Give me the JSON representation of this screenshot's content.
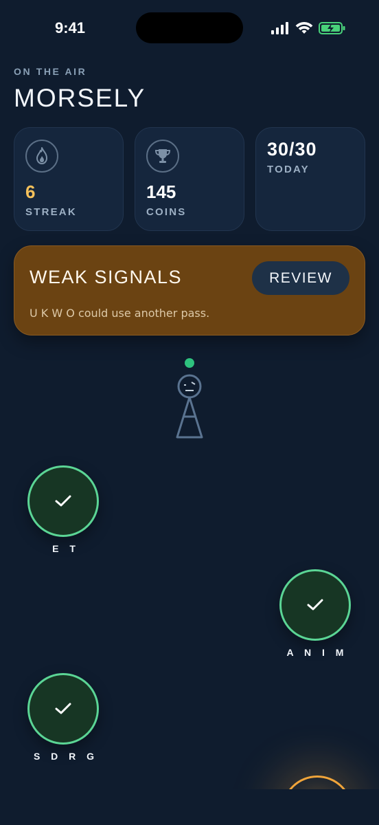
{
  "status_bar": {
    "time": "9:41"
  },
  "header": {
    "kicker": "ON THE AIR",
    "title": "MORSELY"
  },
  "stats": {
    "streak": {
      "value": "6",
      "label": "STREAK",
      "icon": "flame-icon"
    },
    "coins": {
      "value": "145",
      "label": "COINS",
      "icon": "trophy-icon"
    },
    "today": {
      "value": "30/30",
      "label": "TODAY"
    }
  },
  "weak_signals": {
    "title": "WEAK SIGNALS",
    "review_label": "REVIEW",
    "subtitle": "U  K  W  O could use another pass."
  },
  "path": {
    "nodes": [
      {
        "label": "E T",
        "status": "completed"
      },
      {
        "label": "A N I M",
        "status": "completed"
      },
      {
        "label": "S D R G",
        "status": "completed"
      }
    ]
  },
  "colors": {
    "background": "#0f1c2e",
    "card": "#15263d",
    "streak_accent": "#f5c15b",
    "weak_card": "#6b4312",
    "review_button": "#1e3147",
    "node_green": "#5bd595",
    "node_fill": "#173624",
    "orange_glow": "#f0a43a",
    "battery_green": "#49d17a"
  }
}
